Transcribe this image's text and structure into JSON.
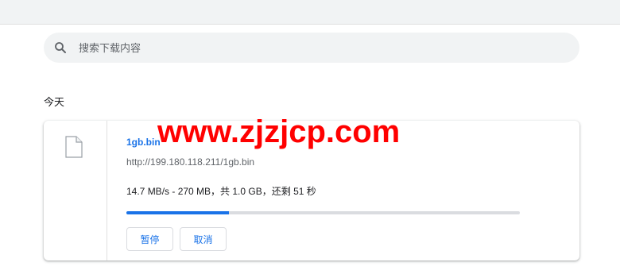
{
  "search": {
    "placeholder": "搜索下载内容"
  },
  "section": {
    "date_label": "今天"
  },
  "download": {
    "file_name": "1gb.bin",
    "url": "http://199.180.118.211/1gb.bin",
    "status_text": "14.7 MB/s - 270 MB，共 1.0 GB，还剩 51 秒",
    "progress_fraction": 0.26,
    "pause_label": "暂停",
    "cancel_label": "取消"
  },
  "watermark": {
    "text": "www.zjzjcp.com"
  },
  "colors": {
    "accent": "#1a73e8",
    "watermark": "#ff0000",
    "progress_track": "#dadce0"
  },
  "icons": {
    "search": "search-icon",
    "file": "file-icon"
  }
}
